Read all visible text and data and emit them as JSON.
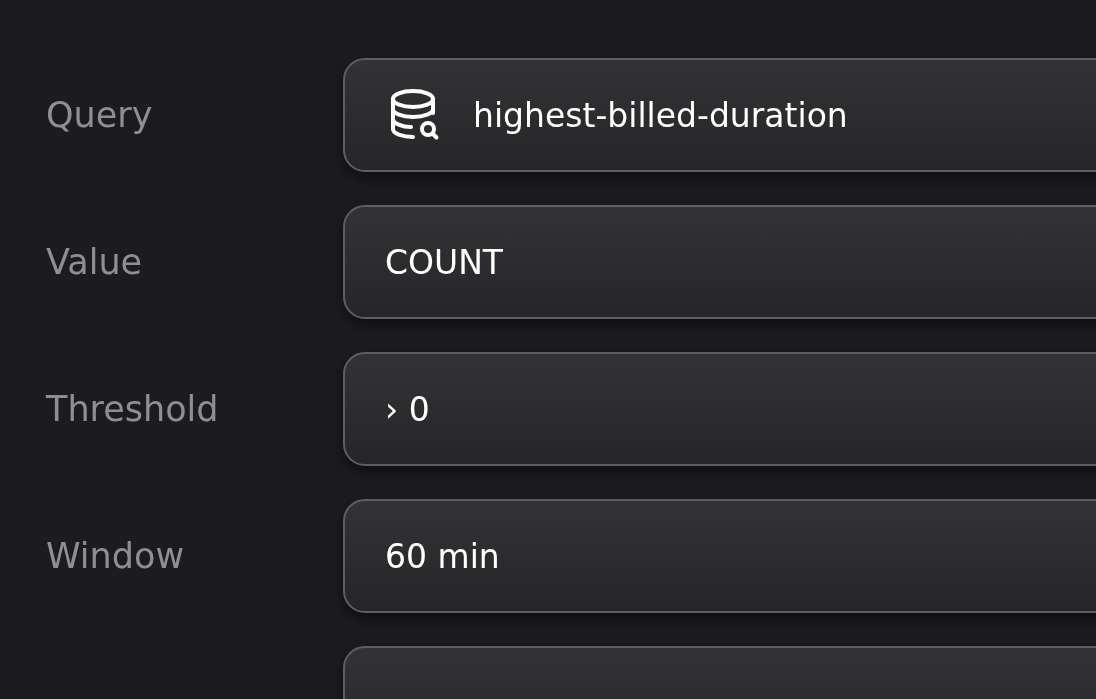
{
  "fields": [
    {
      "label": "Query",
      "value": "highest-billed-duration",
      "kind": "query"
    },
    {
      "label": "Value",
      "value": "COUNT",
      "kind": "plain"
    },
    {
      "label": "Threshold",
      "value": "› 0",
      "kind": "plain"
    },
    {
      "label": "Window",
      "value": "60 min",
      "kind": "plain"
    }
  ]
}
